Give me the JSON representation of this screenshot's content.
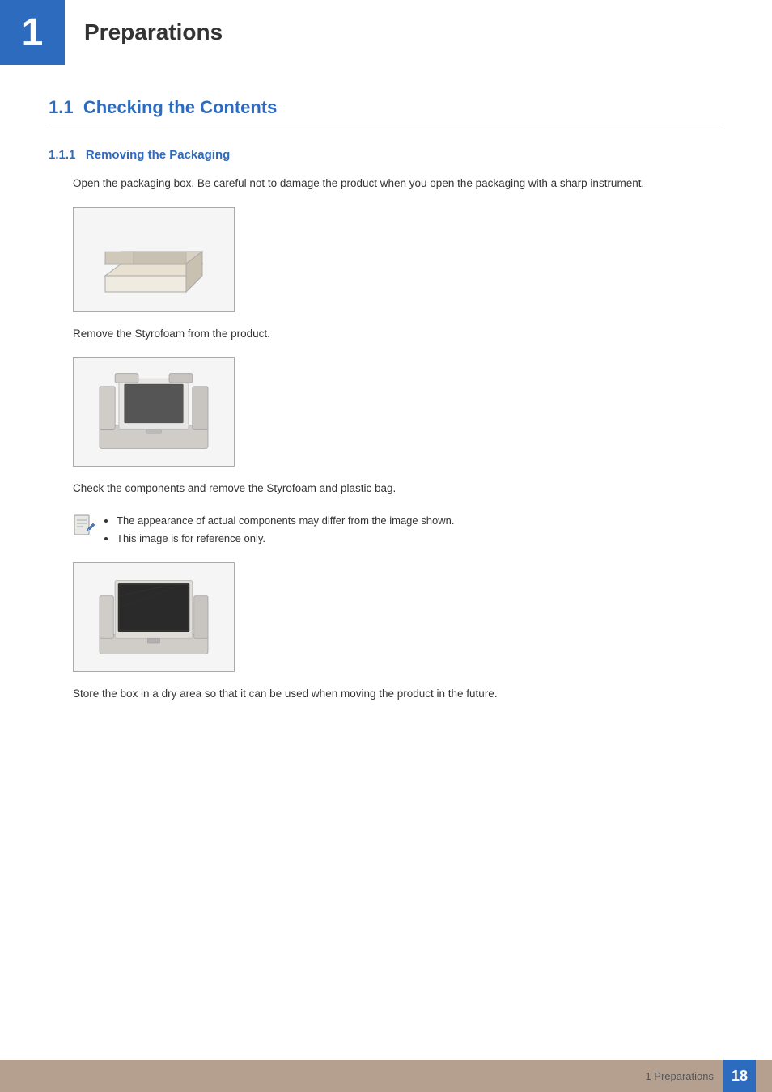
{
  "header": {
    "chapter_number": "1",
    "chapter_title": "Preparations"
  },
  "section_11": {
    "number": "1.1",
    "title": "Checking the Contents"
  },
  "section_111": {
    "number": "1.1.1",
    "title": "Removing the Packaging"
  },
  "paragraphs": {
    "open_box": "Open the packaging box. Be careful not to damage the product when you open the packaging with a sharp instrument.",
    "remove_styrofoam": "Remove the Styrofoam from the product.",
    "check_components": "Check the components and remove the Styrofoam and plastic bag.",
    "store_box": "Store the box in a dry area so that it can be used when moving the product in the future."
  },
  "notes": {
    "note1": "The appearance of actual components may differ from the image shown.",
    "note2": "This image is for reference only."
  },
  "footer": {
    "text": "1 Preparations",
    "page_number": "18"
  }
}
